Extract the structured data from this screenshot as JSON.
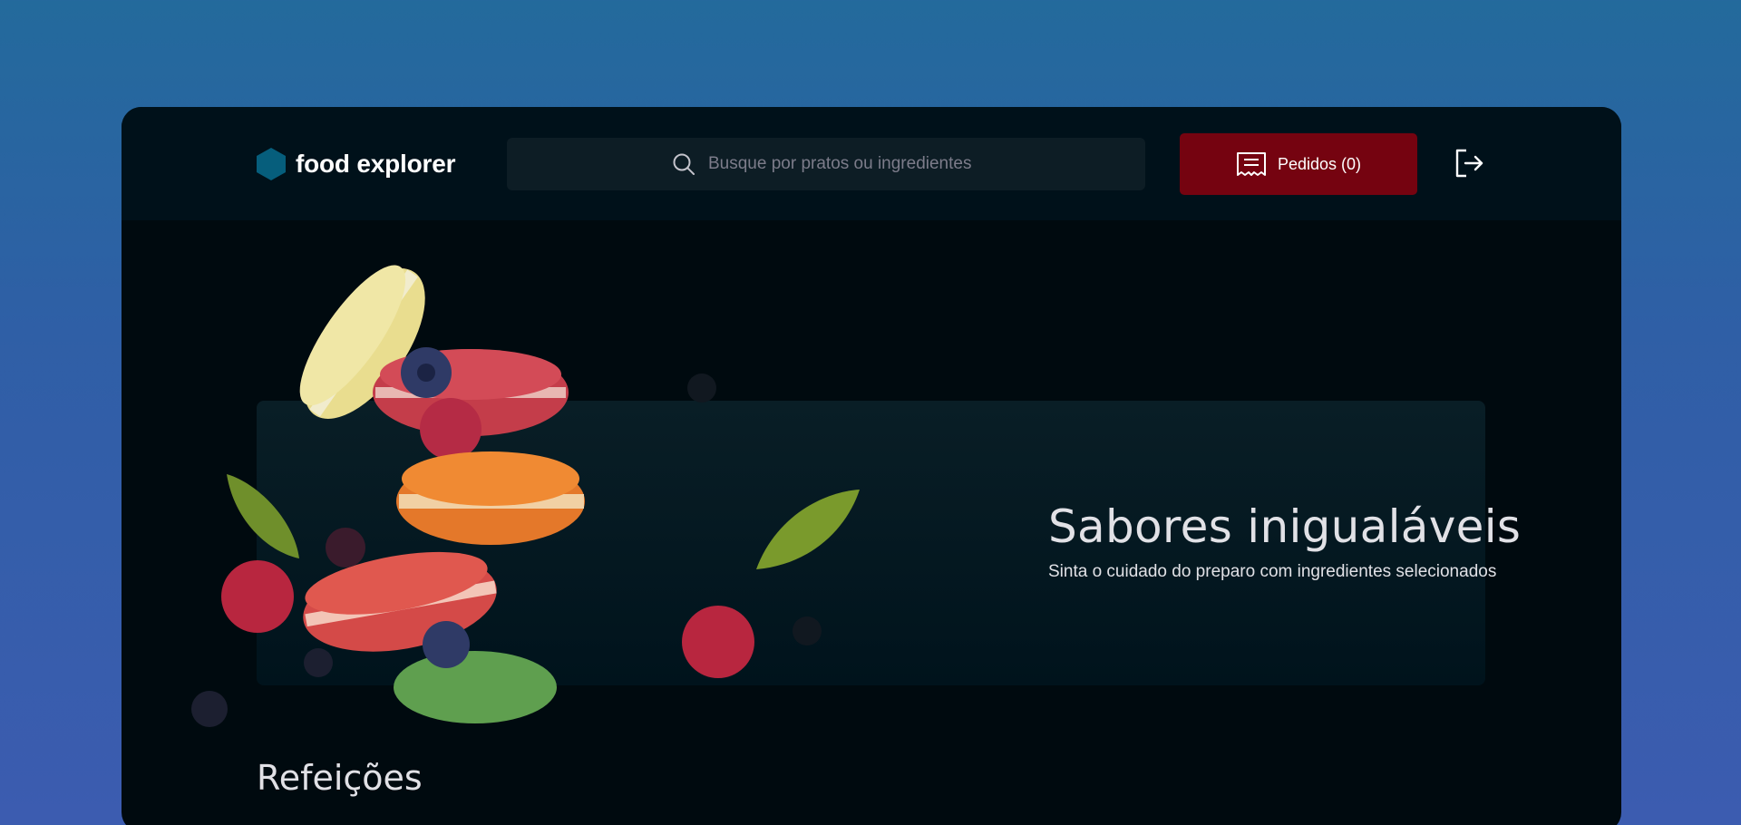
{
  "header": {
    "brand": "food explorer",
    "search_placeholder": "Busque por pratos ou ingredientes",
    "orders_label": "Pedidos (0)"
  },
  "banner": {
    "title": "Sabores inigualáveis",
    "subtitle": "Sinta o cuidado do preparo com ingredientes selecionados"
  },
  "section": {
    "title": "Refeições"
  },
  "colors": {
    "brand_hexagon": "#065e7c",
    "orders_button": "#750310",
    "app_background": "#000a0f",
    "header_background": "#00111a"
  },
  "icons": [
    "hexagon-logo-icon",
    "search-icon",
    "receipt-icon",
    "sign-out-icon"
  ]
}
